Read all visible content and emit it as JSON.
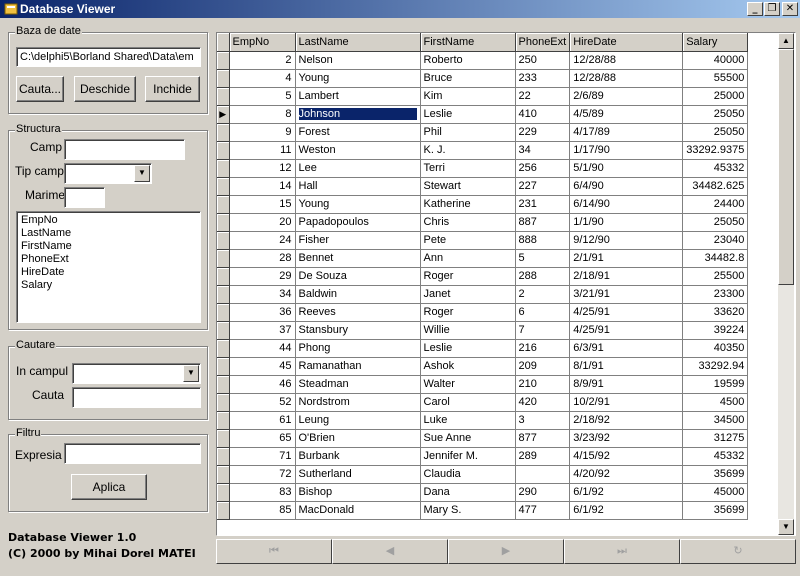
{
  "window": {
    "title": "Database Viewer",
    "controls": [
      "_",
      "❐",
      "✕"
    ]
  },
  "baza": {
    "title": "Baza de date",
    "path": "C:\\delphi5\\Borland Shared\\Data\\em",
    "btn_cauta": "Cauta...",
    "btn_deschide": "Deschide",
    "btn_inchide": "Inchide"
  },
  "structura": {
    "title": "Structura",
    "camp_label": "Camp",
    "camp_value": "",
    "tip_label": "Tip camp",
    "tip_value": "",
    "marime_label": "Marime",
    "marime_value": "",
    "fields": [
      "EmpNo",
      "LastName",
      "FirstName",
      "PhoneExt",
      "HireDate",
      "Salary"
    ]
  },
  "cautare": {
    "title": "Cautare",
    "campul_label": "In campul",
    "campul_value": "",
    "cauta_label": "Cauta",
    "cauta_value": ""
  },
  "filtru": {
    "title": "Filtru",
    "expresia_label": "Expresia",
    "expresia_value": "",
    "btn_aplica": "Aplica"
  },
  "about": {
    "line1": "Database Viewer 1.0",
    "line2": "(C) 2000 by Mihai Dorel MATEI"
  },
  "grid": {
    "columns": [
      "EmpNo",
      "LastName",
      "FirstName",
      "PhoneExt",
      "HireDate",
      "Salary"
    ],
    "current_row_indicator": "▶",
    "rows": [
      [
        "2",
        "Nelson",
        "Roberto",
        "250",
        "12/28/88",
        "40000"
      ],
      [
        "4",
        "Young",
        "Bruce",
        "233",
        "12/28/88",
        "55500"
      ],
      [
        "5",
        "Lambert",
        "Kim",
        "22",
        "2/6/89",
        "25000"
      ],
      [
        "8",
        "Johnson",
        "Leslie",
        "410",
        "4/5/89",
        "25050"
      ],
      [
        "9",
        "Forest",
        "Phil",
        "229",
        "4/17/89",
        "25050"
      ],
      [
        "11",
        "Weston",
        "K. J.",
        "34",
        "1/17/90",
        "33292.9375"
      ],
      [
        "12",
        "Lee",
        "Terri",
        "256",
        "5/1/90",
        "45332"
      ],
      [
        "14",
        "Hall",
        "Stewart",
        "227",
        "6/4/90",
        "34482.625"
      ],
      [
        "15",
        "Young",
        "Katherine",
        "231",
        "6/14/90",
        "24400"
      ],
      [
        "20",
        "Papadopoulos",
        "Chris",
        "887",
        "1/1/90",
        "25050"
      ],
      [
        "24",
        "Fisher",
        "Pete",
        "888",
        "9/12/90",
        "23040"
      ],
      [
        "28",
        "Bennet",
        "Ann",
        "5",
        "2/1/91",
        "34482.8"
      ],
      [
        "29",
        "De Souza",
        "Roger",
        "288",
        "2/18/91",
        "25500"
      ],
      [
        "34",
        "Baldwin",
        "Janet",
        "2",
        "3/21/91",
        "23300"
      ],
      [
        "36",
        "Reeves",
        "Roger",
        "6",
        "4/25/91",
        "33620"
      ],
      [
        "37",
        "Stansbury",
        "Willie",
        "7",
        "4/25/91",
        "39224"
      ],
      [
        "44",
        "Phong",
        "Leslie",
        "216",
        "6/3/91",
        "40350"
      ],
      [
        "45",
        "Ramanathan",
        "Ashok",
        "209",
        "8/1/91",
        "33292.94"
      ],
      [
        "46",
        "Steadman",
        "Walter",
        "210",
        "8/9/91",
        "19599"
      ],
      [
        "52",
        "Nordstrom",
        "Carol",
        "420",
        "10/2/91",
        "4500"
      ],
      [
        "61",
        "Leung",
        "Luke",
        "3",
        "2/18/92",
        "34500"
      ],
      [
        "65",
        "O'Brien",
        "Sue Anne",
        "877",
        "3/23/92",
        "31275"
      ],
      [
        "71",
        "Burbank",
        "Jennifer M.",
        "289",
        "4/15/92",
        "45332"
      ],
      [
        "72",
        "Sutherland",
        "Claudia",
        "",
        "4/20/92",
        "35699"
      ],
      [
        "83",
        "Bishop",
        "Dana",
        "290",
        "6/1/92",
        "45000"
      ],
      [
        "85",
        "MacDonald",
        "Mary S.",
        "477",
        "6/1/92",
        "35699"
      ]
    ],
    "selected_row": 3
  },
  "navigator": [
    "⏮",
    "◀",
    "▶",
    "⏭",
    "↻"
  ]
}
